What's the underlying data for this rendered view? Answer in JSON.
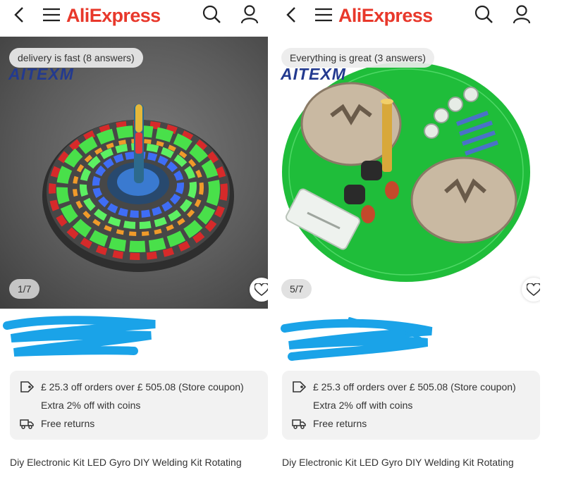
{
  "logo_text": "AliExpress",
  "left": {
    "qa_pill": "delivery is fast (8 answers)",
    "brand_mark": "AITEXM",
    "image_counter": "1/7",
    "coupon": "£ 25.3 off orders over  £ 505.08 (Store coupon)",
    "coins": "Extra 2% off with coins",
    "returns": "Free returns",
    "title": "Diy Electronic Kit LED Gyro DIY Welding Kit Rotating"
  },
  "right": {
    "qa_pill": "Everything is great (3 answers)",
    "brand_mark": "AITEXM",
    "image_counter": "5/7",
    "coupon": "£ 25.3 off orders over  £ 505.08 (Store coupon)",
    "coins": "Extra 2% off with coins",
    "returns": "Free returns",
    "title": "Diy Electronic Kit LED Gyro DIY Welding Kit Rotating"
  },
  "colors": {
    "brand_red": "#e8382b",
    "redaction_blue": "#1aa3e8",
    "card_bg": "#f2f2f2"
  },
  "icons": [
    "back-arrow-icon",
    "menu-icon",
    "search-icon",
    "account-icon",
    "heart-icon",
    "coupon-tag-icon",
    "delivery-truck-icon"
  ]
}
